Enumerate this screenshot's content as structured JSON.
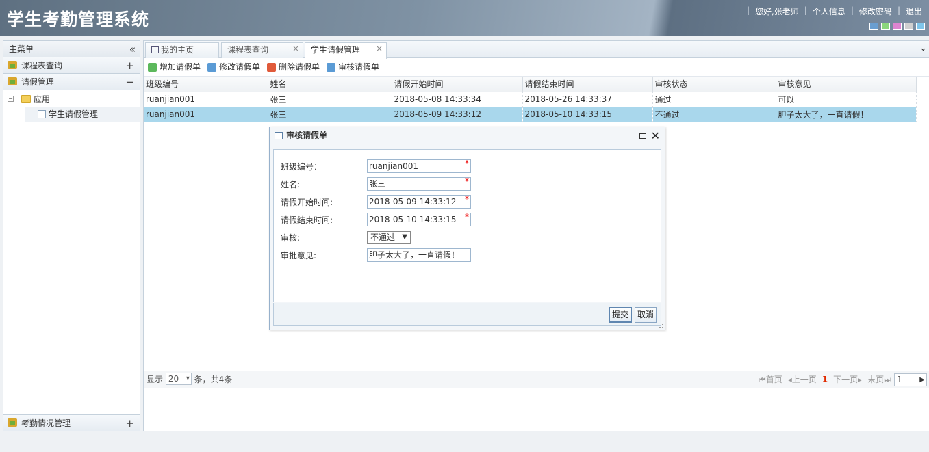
{
  "header": {
    "title": "学生考勤管理系统",
    "links": [
      "您好,张老师",
      "个人信息",
      "修改密码",
      "退出"
    ],
    "theme_colors": [
      "#6a9ed0",
      "#8bd67c",
      "#de84d0",
      "#cfcfcf",
      "#7fc5ea"
    ]
  },
  "sidebar": {
    "title": "主菜单",
    "sections": [
      {
        "label": "课程表查询",
        "tool": "+"
      },
      {
        "label": "请假管理",
        "tool": "−"
      },
      {
        "label": "考勤情况管理",
        "tool": "+"
      }
    ],
    "tree": {
      "folder": "应用",
      "item": "学生请假管理"
    }
  },
  "tabs": [
    {
      "label": "我的主页"
    },
    {
      "label": "课程表查询"
    },
    {
      "label": "学生请假管理"
    }
  ],
  "toolbar": {
    "add": "增加请假单",
    "edit": "修改请假单",
    "delete": "删除请假单",
    "review": "审核请假单"
  },
  "grid": {
    "columns": [
      "班级编号",
      "姓名",
      "请假开始时间",
      "请假结束时间",
      "审核状态",
      "审核意见"
    ],
    "rows": [
      [
        "ruanjian001",
        "张三",
        "2018-05-08 14:33:34",
        "2018-05-26 14:33:37",
        "通过",
        "可以"
      ],
      [
        "ruanjian001",
        "张三",
        "2018-05-09 14:33:12",
        "2018-05-10 14:33:15",
        "不通过",
        "胆子太大了，一直请假！"
      ]
    ]
  },
  "pager": {
    "show_label": "显示",
    "page_size": "20",
    "suffix": "条，共4条",
    "first": "首页",
    "prev": "上一页",
    "current": "1",
    "next": "下一页",
    "last": "末页",
    "goto": "1"
  },
  "dialog": {
    "title": "审核请假单",
    "fields": {
      "class_label": "班级编号：",
      "class_value": "ruanjian001",
      "name_label": "姓名:",
      "name_value": "张三",
      "start_label": "请假开始时间:",
      "start_value": "2018-05-09 14:33:12",
      "end_label": "请假结束时间:",
      "end_value": "2018-05-10 14:33:15",
      "review_label": "审核:",
      "review_value": "不通过",
      "opinion_label": "审批意见:",
      "opinion_value": "胆子太大了，一直请假！"
    },
    "submit": "提交",
    "cancel": "取消"
  }
}
